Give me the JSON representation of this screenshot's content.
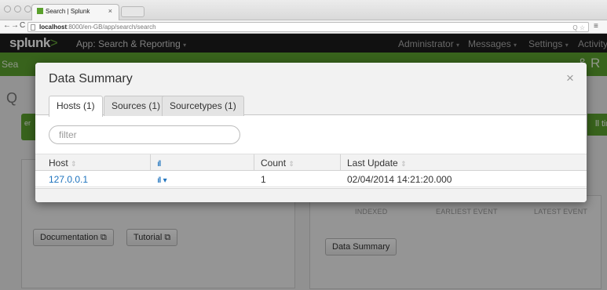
{
  "browser": {
    "tab_title": "Search | Splunk",
    "tab_close": "×",
    "back": "←",
    "forward": "→",
    "reload": "C",
    "url_host": "localhost",
    "url_rest": ":8000/en-GB/app/search/search",
    "url_right_icons": "Q ☆",
    "wrench": "≡"
  },
  "app_bar": {
    "logo_text": "splunk",
    "logo_gt": ">",
    "app_label": "App: Search & Reporting",
    "caret": "▾",
    "nav": [
      {
        "label": "Administrator"
      },
      {
        "label": "Messages"
      },
      {
        "label": "Settings"
      },
      {
        "label": "Activity"
      }
    ]
  },
  "green_bar": {
    "left_text": "Sea",
    "right_text": "& R"
  },
  "page_bg": {
    "search_icon": "Q",
    "green_btn_text": "er",
    "time_btn_text": "ll time",
    "documentation_button": "Documentation ⧉",
    "tutorial_button": "Tutorial ⧉",
    "data_summary_button": "Data Summary",
    "stat_indexed": "INDEXED",
    "stat_earliest": "EARLIEST EVENT",
    "stat_latest": "LATEST EVENT"
  },
  "modal": {
    "title": "Data Summary",
    "close": "×",
    "tabs": [
      {
        "label": "Hosts (1)",
        "active": true
      },
      {
        "label": "Sources (1)",
        "active": false
      },
      {
        "label": "Sourcetypes (1)",
        "active": false
      }
    ],
    "filter_placeholder": "filter",
    "columns": {
      "host": "Host",
      "sparkline": "ıll",
      "count": "Count",
      "last_update": "Last Update",
      "sort_icon": "⇕"
    },
    "rows": [
      {
        "host": "127.0.0.1",
        "sparkline": "ıll",
        "sparkline_caret": "▾",
        "count": "1",
        "last_update": "02/04/2014 14:21:20.000"
      }
    ]
  }
}
